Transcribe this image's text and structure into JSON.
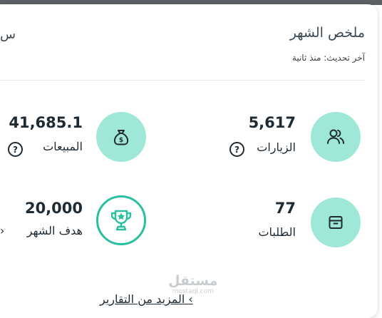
{
  "summary": {
    "title": "ملخص الشهر",
    "last_update": "آخر تحديث: منذ ثانية",
    "cut_off_text": "س"
  },
  "stats": {
    "visits": {
      "value": "5,617",
      "label": "الزيارات",
      "icon": "users-icon"
    },
    "sales": {
      "value": "41,685.1",
      "label": "المبيعات",
      "icon": "money-bag-icon"
    },
    "orders": {
      "value": "77",
      "label": "الطلبات",
      "icon": "box-icon"
    },
    "monthly_goal": {
      "value": "20,000",
      "label": "هدف الشهر",
      "icon": "trophy-icon"
    }
  },
  "help_glyph": "?",
  "more_reports": "المزيد من التقارير",
  "chevron": "›",
  "watermark": {
    "arabic": "مستقل",
    "latin": "mostaql.com"
  },
  "colors": {
    "accent_light": "#9fe8d7",
    "accent": "#2bbfa2",
    "text": "#1f2a33"
  }
}
